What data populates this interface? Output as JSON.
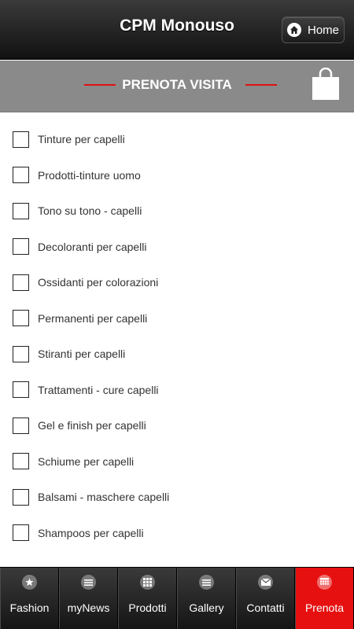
{
  "header": {
    "title": "CPM Monouso",
    "home_label": "Home"
  },
  "banner": {
    "label": "PRENOTA VISITA"
  },
  "list": {
    "items": [
      "Tinture per capelli",
      "Prodotti-tinture uomo",
      "Tono su tono - capelli",
      "Decoloranti per capelli",
      "Ossidanti per colorazioni",
      "Permanenti per capelli",
      "Stiranti per capelli",
      "Trattamenti - cure capelli",
      "Gel e finish per capelli",
      "Schiume per capelli",
      "Balsami - maschere capelli",
      "Shampoos per capelli"
    ]
  },
  "tabs": [
    {
      "label": "Fashion",
      "icon": "star-icon"
    },
    {
      "label": "myNews",
      "icon": "list-icon"
    },
    {
      "label": "Prodotti",
      "icon": "grid-icon"
    },
    {
      "label": "Gallery",
      "icon": "list-icon"
    },
    {
      "label": "Contatti",
      "icon": "mail-icon"
    },
    {
      "label": "Prenota",
      "icon": "calendar-icon"
    }
  ],
  "colors": {
    "accent": "#e61010",
    "banner": "#8a8a8a",
    "header": "#1e1e1e"
  }
}
